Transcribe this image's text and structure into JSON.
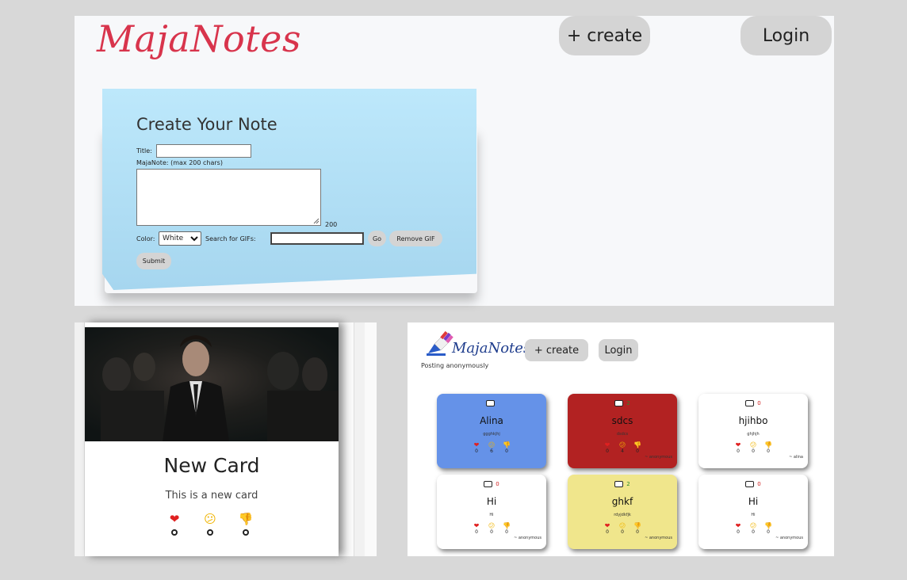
{
  "top_panel": {
    "brand": "MajaNotes",
    "create_label": "+ create",
    "login_label": "Login",
    "form": {
      "heading": "Create Your Note",
      "title_label": "Title:",
      "note_label": "MajaNote: (max 200 chars)",
      "char_count": "200",
      "color_label": "Color:",
      "color_value": "White",
      "gif_label": "Search for GIFs:",
      "go_label": "Go",
      "remove_gif_label": "Remove GIF",
      "submit_label": "Submit"
    }
  },
  "preview_card": {
    "title": "New Card",
    "body": "This is a new card",
    "reactions": [
      {
        "icon": "heart-icon",
        "glyph": "❤",
        "count": "0",
        "color": "#e02020"
      },
      {
        "icon": "confused-face-icon",
        "glyph": "😕",
        "count": "0",
        "color": "#f0b400"
      },
      {
        "icon": "thumbs-down-icon",
        "glyph": "👎",
        "count": "0",
        "color": "#f0b400"
      }
    ]
  },
  "feed_panel": {
    "brand": "MajaNotes",
    "create_label": "+ create",
    "login_label": "Login",
    "anon_text": "Posting anonymously",
    "cards": [
      {
        "title": "Alina",
        "body": "ggghkjhj",
        "comments": "",
        "bg": "#6592e8",
        "author": "",
        "counts": [
          "0",
          "6",
          "0"
        ],
        "comment_color": "#2a8a2a"
      },
      {
        "title": "sdcs",
        "body": "dsdcs",
        "comments": "2",
        "bg": "#b22222",
        "author": "~ anonymous",
        "counts": [
          "0",
          "4",
          "0"
        ],
        "comment_color": "#2a8a2a"
      },
      {
        "title": "hjihbo",
        "body": "ghjhjh",
        "comments": "0",
        "bg": "#ffffff",
        "author": "~ alina",
        "counts": [
          "0",
          "0",
          "0"
        ],
        "comment_color": "#d02020"
      },
      {
        "title": "Hi",
        "body": "Hi",
        "comments": "0",
        "bg": "#ffffff",
        "author": "~ anonymous",
        "counts": [
          "0",
          "0",
          "0"
        ],
        "comment_color": "#d02020"
      },
      {
        "title": "ghkf",
        "body": "rdyjdkfjk",
        "comments": "2",
        "bg": "#f0e68c",
        "author": "~ anonymous",
        "counts": [
          "0",
          "0",
          "0"
        ],
        "comment_color": "#2a8a2a"
      },
      {
        "title": "Hi",
        "body": "Hi",
        "comments": "0",
        "bg": "#ffffff",
        "author": "~ anonymous",
        "counts": [
          "0",
          "0",
          "0"
        ],
        "comment_color": "#d02020"
      }
    ]
  }
}
